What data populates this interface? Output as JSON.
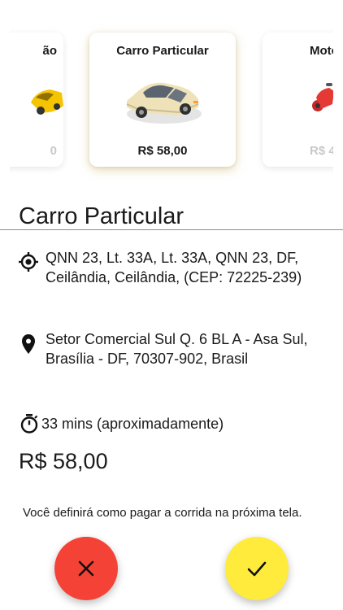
{
  "colors": {
    "cancel": "#f44336",
    "confirm": "#ffeb3b",
    "card_selected_glow": "#c9a23a",
    "muted_price": "#c8c8c8"
  },
  "carousel": {
    "left_card": {
      "title_fragment": "ão",
      "price_fragment": "0",
      "icon": "taxi-icon"
    },
    "selected_card": {
      "title": "Carro Particular",
      "price": "R$ 58,00",
      "icon": "car-icon"
    },
    "right_card": {
      "title_fragment": "Moto",
      "price_fragment": "R$ 4",
      "icon": "motorcycle-icon"
    }
  },
  "ride": {
    "vehicle_name": "Carro Particular",
    "origin": "QNN 23, Lt. 33A, Lt. 33A, QNN 23, DF, Ceilândia, Ceilândia, (CEP: 72225-239)",
    "destination": "Setor Comercial Sul Q. 6 BL A - Asa Sul, Brasília - DF, 70307-902, Brasil",
    "duration": "33 mins (aproximadamente)",
    "price": "R$ 58,00",
    "payment_note": "Você definirá como pagar a corrida na próxima tela."
  },
  "actions": {
    "cancel_icon": "close-icon",
    "confirm_icon": "check-icon"
  }
}
